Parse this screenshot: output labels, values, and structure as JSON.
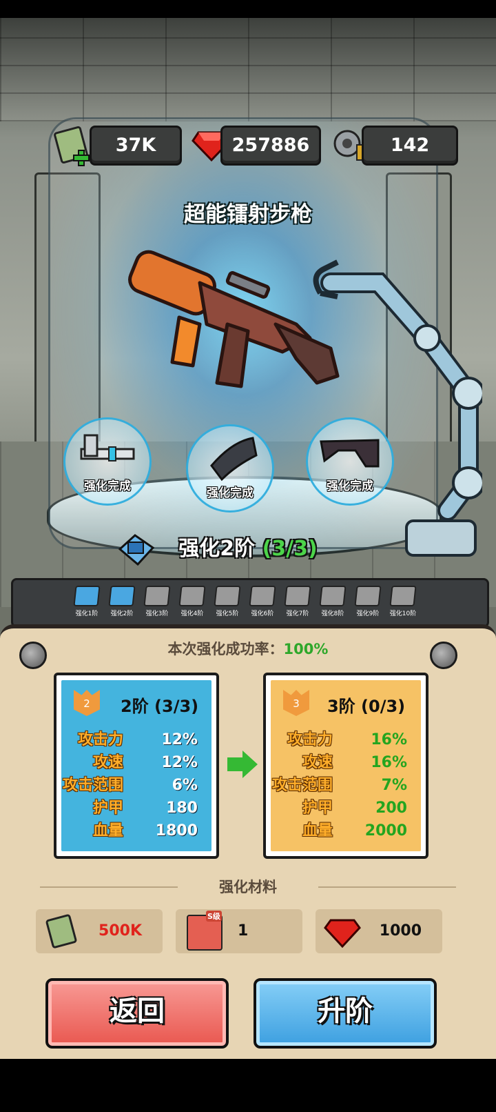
{
  "resources": {
    "cash": "37K",
    "gems": "257886",
    "parts": "142"
  },
  "weapon_name": "超能镭射步枪",
  "parts": [
    {
      "label": "强化完成",
      "icon": "barrel-part-icon"
    },
    {
      "label": "强化完成",
      "icon": "magazine-part-icon"
    },
    {
      "label": "强化完成",
      "icon": "stock-part-icon"
    }
  ],
  "stage": {
    "label": "强化2阶",
    "progress": "(3/3)"
  },
  "tiers": [
    "强化1阶",
    "强化2阶",
    "强化3阶",
    "强化4阶",
    "强化5阶",
    "强化6阶",
    "强化7阶",
    "强化8阶",
    "强化9阶",
    "强化10阶"
  ],
  "tiers_unlocked": 2,
  "success_rate": {
    "label": "本次强化成功率：",
    "value": "100%"
  },
  "current": {
    "badge": "2",
    "title": "2阶 (3/3)",
    "stats": [
      {
        "key": "攻击力",
        "value": "12%"
      },
      {
        "key": "攻速",
        "value": "12%"
      },
      {
        "key": "攻击范围",
        "value": "6%"
      },
      {
        "key": "护甲",
        "value": "180"
      },
      {
        "key": "血量",
        "value": "1800"
      }
    ]
  },
  "next": {
    "badge": "3",
    "title": "3阶 (0/3)",
    "stats": [
      {
        "key": "攻击力",
        "value": "16%"
      },
      {
        "key": "攻速",
        "value": "16%"
      },
      {
        "key": "攻击范围",
        "value": "7%"
      },
      {
        "key": "护甲",
        "value": "200"
      },
      {
        "key": "血量",
        "value": "2000"
      }
    ]
  },
  "materials_title": "强化材料",
  "materials": [
    {
      "icon": "cash-stack-icon",
      "value": "500K"
    },
    {
      "icon": "weapon-card-icon",
      "tag": "S级",
      "value": "1"
    },
    {
      "icon": "ruby-icon",
      "value": "1000"
    }
  ],
  "buttons": {
    "back": "返回",
    "upgrade": "升阶"
  },
  "colors": {
    "insufficient": "#e0231c",
    "bonus": "#24a51f",
    "current_card": "#44b4de",
    "next_card": "#f6c265"
  }
}
